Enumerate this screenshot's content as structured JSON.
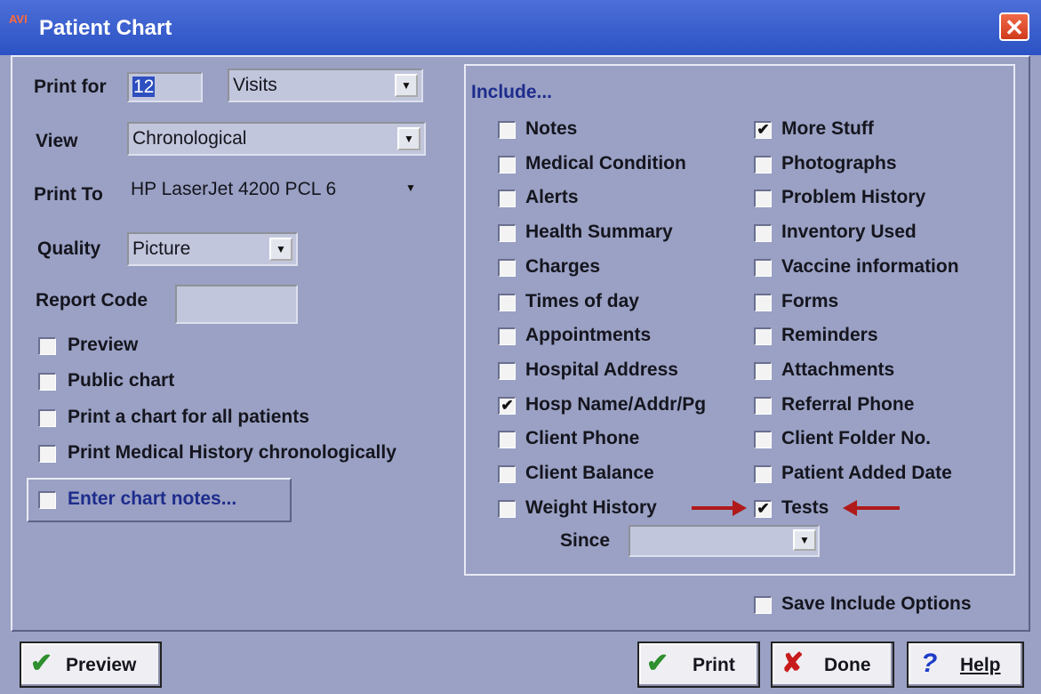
{
  "window": {
    "title": "Patient Chart",
    "app_badge": "AVI",
    "close_glyph": "✕"
  },
  "left": {
    "print_for": {
      "label": "Print for",
      "value": "12",
      "unit": "Visits"
    },
    "view": {
      "label": "View",
      "value": "Chronological"
    },
    "print_to": {
      "label": "Print To",
      "value": "HP LaserJet 4200 PCL 6"
    },
    "quality": {
      "label": "Quality",
      "value": "Picture"
    },
    "report_code": {
      "label": "Report Code",
      "value": ""
    },
    "options": [
      {
        "label": "Preview",
        "checked": false
      },
      {
        "label": "Public chart",
        "checked": false
      },
      {
        "label": "Print a chart for all patients",
        "checked": false
      },
      {
        "label": "Print Medical History chronologically",
        "checked": false
      }
    ],
    "chart_notes": {
      "label": "Enter chart notes...",
      "checked": false
    }
  },
  "include": {
    "title": "Include...",
    "col1": [
      {
        "label": "Notes",
        "checked": false
      },
      {
        "label": "Medical Condition",
        "checked": false
      },
      {
        "label": "Alerts",
        "checked": false
      },
      {
        "label": "Health Summary",
        "checked": false
      },
      {
        "label": "Charges",
        "checked": false
      },
      {
        "label": "Times of day",
        "checked": false
      },
      {
        "label": "Appointments",
        "checked": false
      },
      {
        "label": "Hospital Address",
        "checked": false
      },
      {
        "label": "Hosp Name/Addr/Pg",
        "checked": true
      },
      {
        "label": "Client Phone",
        "checked": false
      },
      {
        "label": "Client Balance",
        "checked": false
      },
      {
        "label": "Weight History",
        "checked": false
      }
    ],
    "col2": [
      {
        "label": "More Stuff",
        "checked": true
      },
      {
        "label": "Photographs",
        "checked": false
      },
      {
        "label": "Problem History",
        "checked": false
      },
      {
        "label": "Inventory Used",
        "checked": false
      },
      {
        "label": "Vaccine information",
        "checked": false
      },
      {
        "label": "Forms",
        "checked": false
      },
      {
        "label": "Reminders",
        "checked": false
      },
      {
        "label": "Attachments",
        "checked": false
      },
      {
        "label": "Referral Phone",
        "checked": false
      },
      {
        "label": "Client Folder No.",
        "checked": false
      },
      {
        "label": "Patient Added Date",
        "checked": false
      },
      {
        "label": "Tests",
        "checked": true
      }
    ],
    "since": {
      "label": "Since",
      "value": ""
    }
  },
  "save_include": {
    "label": "Save Include Options",
    "checked": false
  },
  "buttons": {
    "preview": "Preview",
    "print": "Print",
    "done": "Done",
    "help": "Help"
  },
  "colors": {
    "window_bg": "#9aa1c4",
    "titlebar": "#2b52c4",
    "include_title": "#1e2c8c",
    "annotation_arrow": "#b01a1a"
  },
  "icons": {
    "check": "check-icon",
    "x": "x-icon",
    "help": "question-mark-icon"
  }
}
